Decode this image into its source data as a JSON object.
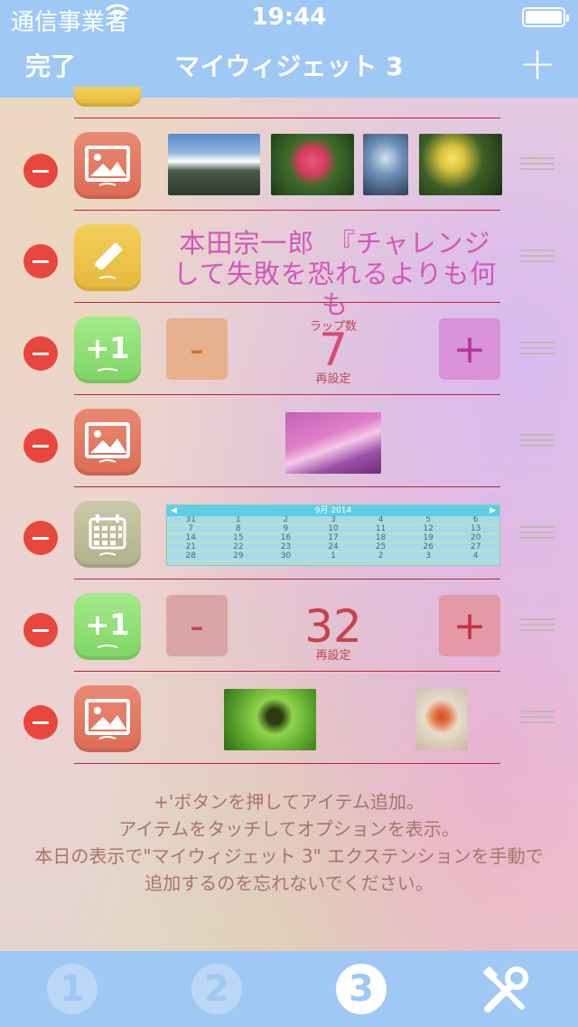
{
  "status_bar": {
    "carrier": "通信事業者",
    "time": "19:44"
  },
  "nav": {
    "done_label": "完了",
    "title": "マイウィジェット 3"
  },
  "widgets": {
    "memo_text": "本田宗一郎　『チャレンジして失敗を恐れるよりも何も",
    "lap_counter": {
      "caption": "ラップ数",
      "value": "7",
      "minus": "-",
      "plus": "+",
      "reset": "再設定"
    },
    "counter2": {
      "value": "32",
      "minus": "-",
      "plus": "+",
      "reset": "再設定"
    },
    "calendar": {
      "month": "9月 2014",
      "rows": [
        [
          "31",
          "1",
          "2",
          "3",
          "4",
          "5",
          "6"
        ],
        [
          "7",
          "8",
          "9",
          "10",
          "11",
          "12",
          "13"
        ],
        [
          "14",
          "15",
          "16",
          "17",
          "18",
          "19",
          "20"
        ],
        [
          "21",
          "22",
          "23",
          "24",
          "25",
          "26",
          "27"
        ],
        [
          "28",
          "29",
          "30",
          "1",
          "2",
          "3",
          "4"
        ]
      ]
    }
  },
  "footer_note": {
    "line1": "+'ボタンを押してアイテム追加。",
    "line2": "アイテムをタッチしてオプションを表示。",
    "line3": "本日の表示で\"マイウィジェット 3\" エクステンションを手動で",
    "line4": "追加するのを忘れないでください。"
  },
  "tabs": [
    "1",
    "2",
    "3"
  ],
  "colors": {
    "bar": "#9fc8f5",
    "delete": "#e8473d",
    "separator": "#b7253f",
    "memo_text": "#d257b7"
  }
}
